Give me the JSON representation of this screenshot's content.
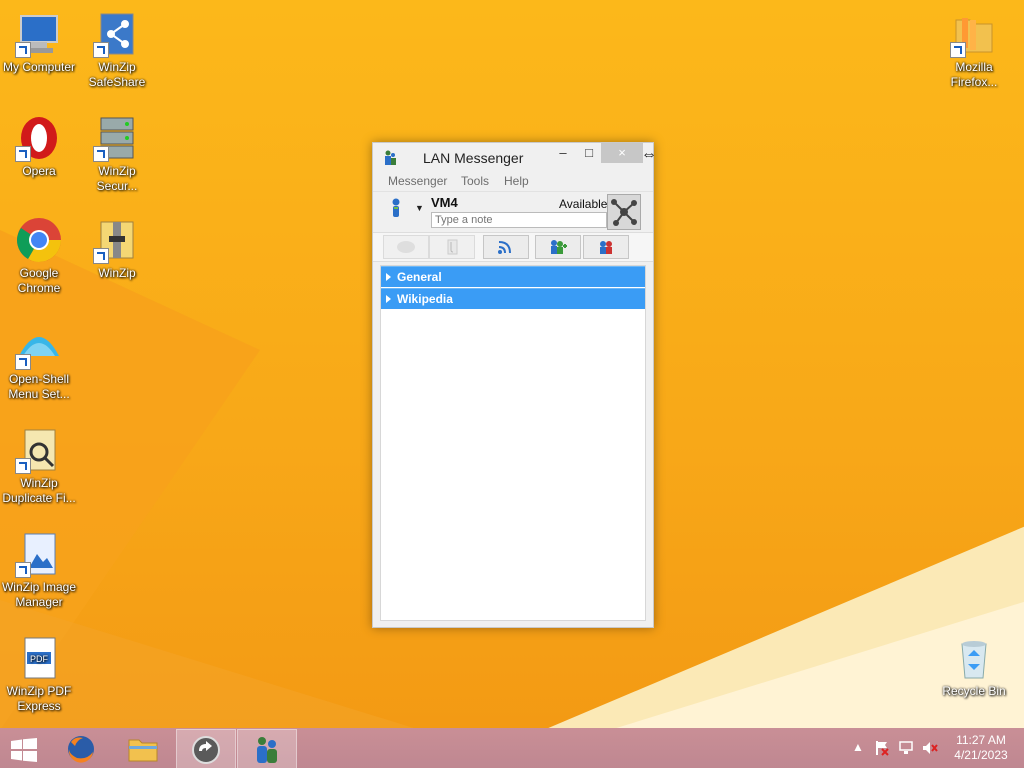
{
  "desktop": {
    "icons": [
      {
        "label": "My Computer",
        "icon": "computer-icon"
      },
      {
        "label": "WinZip SafeShare",
        "icon": "winzip-safeshare-icon"
      },
      {
        "label": "Opera",
        "icon": "opera-icon"
      },
      {
        "label": "WinZip Secur...",
        "icon": "winzip-secure-icon"
      },
      {
        "label": "Google Chrome",
        "icon": "chrome-icon"
      },
      {
        "label": "WinZip",
        "icon": "winzip-icon"
      },
      {
        "label": "Open-Shell Menu Set...",
        "icon": "open-shell-icon"
      },
      {
        "label": "WinZip Duplicate Fi...",
        "icon": "winzip-duplicate-icon"
      },
      {
        "label": "WinZip Image Manager",
        "icon": "winzip-image-icon"
      },
      {
        "label": "WinZip PDF Express",
        "icon": "winzip-pdf-icon"
      },
      {
        "label": "Mozilla Firefox...",
        "icon": "firefox-folder-icon"
      },
      {
        "label": "Recycle Bin",
        "icon": "recycle-bin-icon"
      }
    ]
  },
  "window": {
    "title": "LAN Messenger",
    "controls": {
      "minimize": "–",
      "maximize": "□",
      "close": "×"
    },
    "menu": [
      "Messenger",
      "Tools",
      "Help"
    ],
    "user": {
      "name": "VM4",
      "status": "Available",
      "note_placeholder": "Type a note"
    },
    "toolbar": [
      {
        "name": "chat",
        "icon": "chat-bubble-icon",
        "enabled": false
      },
      {
        "name": "file",
        "icon": "file-transfer-icon",
        "enabled": false
      },
      {
        "name": "broadcast",
        "icon": "broadcast-icon",
        "enabled": true
      },
      {
        "name": "add-contacts",
        "icon": "add-contacts-icon",
        "enabled": true
      },
      {
        "name": "refresh",
        "icon": "refresh-contacts-icon",
        "enabled": true
      }
    ],
    "groups": [
      "General",
      "Wikipedia"
    ]
  },
  "taskbar": {
    "apps": [
      {
        "name": "Firefox",
        "icon": "firefox-icon",
        "active": false
      },
      {
        "name": "File Explorer",
        "icon": "folder-icon",
        "active": false
      },
      {
        "name": "Update",
        "icon": "update-icon",
        "active": true
      },
      {
        "name": "LAN Messenger",
        "icon": "lan-messenger-icon",
        "active": true
      }
    ],
    "tray": {
      "chevron": "▲",
      "time": "11:27 AM",
      "date": "4/21/2023"
    }
  },
  "colors": {
    "desktop_bg": "#fcb81a",
    "group_header": "#3a9cf5",
    "taskbar": "#c98f96"
  }
}
